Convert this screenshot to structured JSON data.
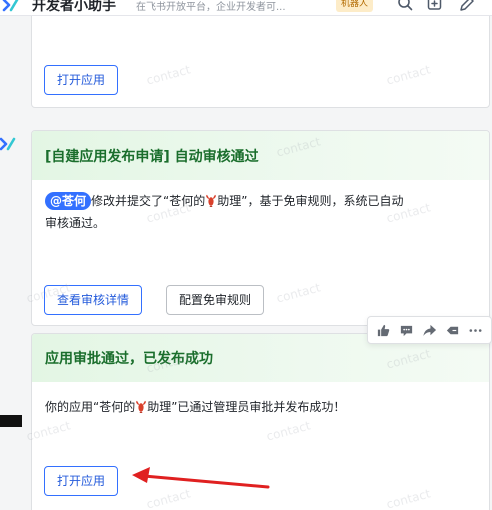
{
  "header": {
    "title": "开发者小助手",
    "description": "在飞书开放平台，企业开发者可...",
    "badge": "机器人"
  },
  "messages": [
    {
      "buttons": {
        "open_app": "打开应用"
      }
    },
    {
      "title": "[自建应用发布申请] 自动审核通过",
      "mention": "@苍何",
      "text_before": "修改并提交了“苍何的",
      "text_after": "助理”，基于免审规则，系统已自动",
      "text_line2": "审核通过。",
      "buttons": {
        "view_details": "查看审核详情",
        "config_rules": "配置免审规则"
      }
    },
    {
      "title": "应用审批通过，已发布成功",
      "text_before": "你的应用“苍何的",
      "text_after": "助理”已通过管理员审批并发布成功！",
      "buttons": {
        "open_app": "打开应用"
      }
    }
  ],
  "watermark_text": "contact",
  "colors": {
    "accent": "#3370ff",
    "card_header_green": "#1a6e2c",
    "arrow": "#e02020"
  }
}
